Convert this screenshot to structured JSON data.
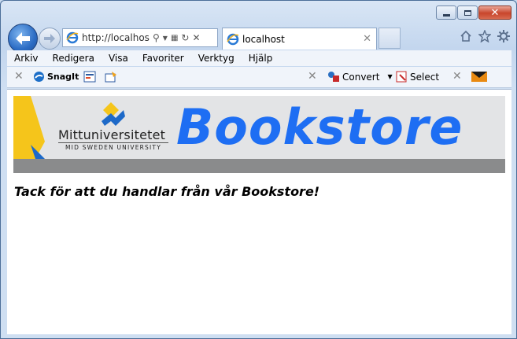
{
  "browser": {
    "address_url": "http://localhost",
    "tab_title": "localhost",
    "menu": [
      "Arkiv",
      "Redigera",
      "Visa",
      "Favoriter",
      "Verktyg",
      "Hjälp"
    ],
    "commands": {
      "snagit": "SnagIt",
      "convert": "Convert",
      "select": "Select"
    },
    "icons": [
      "back-arrow-icon",
      "forward-arrow-icon",
      "ie-icon",
      "search-icon",
      "compat-view-icon",
      "refresh-icon",
      "stop-icon",
      "home-icon",
      "favorites-star-icon",
      "tools-gear-icon"
    ]
  },
  "page": {
    "logo_name": "Mittuniversitetet",
    "logo_sub": "MID SWEDEN UNIVERSITY",
    "title": "Bookstore",
    "message": "Tack för att du handlar från vår Bookstore!",
    "title_color": "#1e6ef3"
  }
}
